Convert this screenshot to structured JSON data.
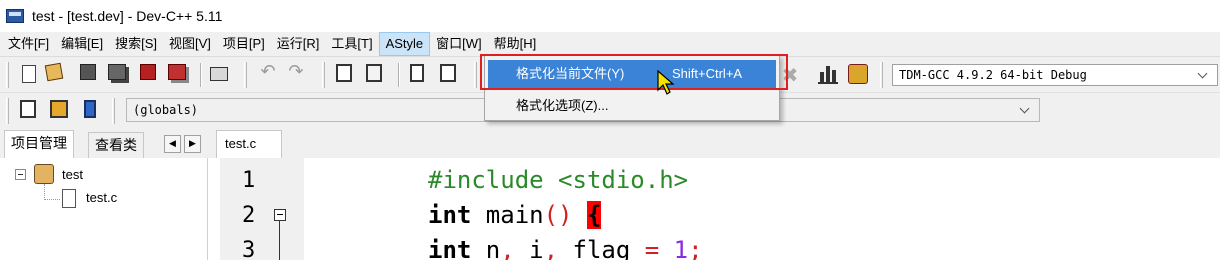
{
  "window": {
    "title": "test - [test.dev] - Dev-C++ 5.11"
  },
  "menubar": {
    "items": [
      "文件[F]",
      "编辑[E]",
      "搜索[S]",
      "视图[V]",
      "项目[P]",
      "运行[R]",
      "工具[T]",
      "AStyle",
      "窗口[W]",
      "帮助[H]"
    ]
  },
  "toolbar": {
    "compiler": "TDM-GCC 4.9.2 64-bit Debug",
    "scope": "(globals)"
  },
  "astyle_menu": {
    "items": [
      {
        "label": "格式化当前文件(Y)",
        "shortcut": "Shift+Ctrl+A"
      },
      {
        "label": "格式化选项(Z)...",
        "shortcut": ""
      }
    ]
  },
  "left_panel": {
    "tabs": [
      "项目管理",
      "查看类"
    ],
    "tree": {
      "project": "test",
      "file": "test.c"
    }
  },
  "editor": {
    "tab": "test.c",
    "line_numbers": [
      "1",
      "2",
      "3"
    ],
    "code": {
      "line1": "#include <stdio.h>",
      "line2_kw": "int",
      "line2_rest": " main",
      "line2_paren": "()",
      "line2_brace": "{",
      "line3_kw": "int",
      "line3_a": " n",
      "line3_c1": ",",
      "line3_b": " i",
      "line3_c2": ",",
      "line3_c": " flag ",
      "line3_eq": "=",
      "line3_num": " 1",
      "line3_semi": ";"
    }
  },
  "colors": {
    "menu_highlight": "#3a83d6",
    "annotation_outline": "#e02020",
    "preprocessor": "#2a8a2a"
  }
}
